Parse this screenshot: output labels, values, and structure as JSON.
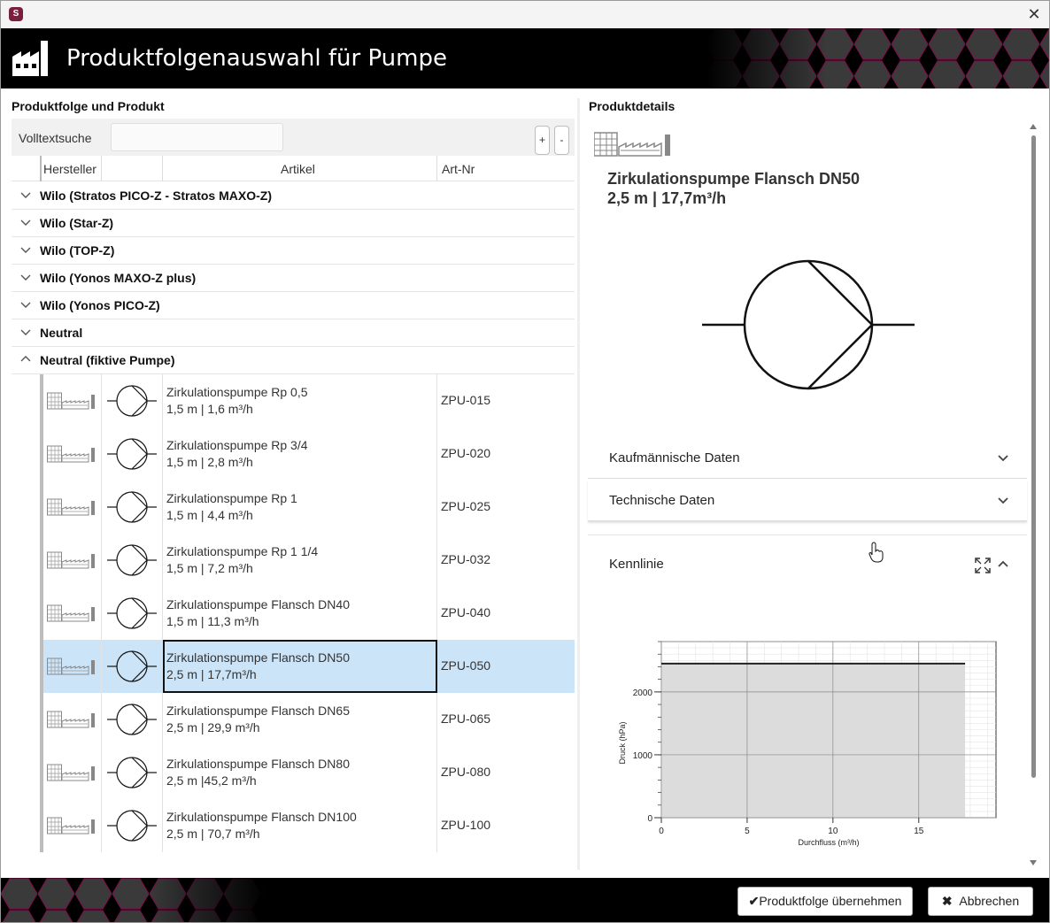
{
  "window": {
    "app_icon_letter": "S"
  },
  "header": {
    "title": "Produktfolgenauswahl für Pumpe"
  },
  "left": {
    "section_title": "Produktfolge und Produkt",
    "search_label": "Volltextsuche",
    "search_value": "",
    "expand_label": "+",
    "collapse_label": "-",
    "columns": {
      "hersteller": "Hersteller",
      "artikel": "Artikel",
      "artnr": "Art-Nr"
    },
    "groups": [
      {
        "label": "Wilo (Stratos PICO-Z - Stratos MAXO-Z)",
        "expanded": false
      },
      {
        "label": "Wilo (Star-Z)",
        "expanded": false
      },
      {
        "label": "Wilo (TOP-Z)",
        "expanded": false
      },
      {
        "label": "Wilo (Yonos MAXO-Z plus)",
        "expanded": false
      },
      {
        "label": "Wilo (Yonos PICO-Z)",
        "expanded": false
      },
      {
        "label": "Neutral",
        "expanded": false
      },
      {
        "label": "Neutral (fiktive Pumpe)",
        "expanded": true
      }
    ],
    "products": [
      {
        "name": "Zirkulationspumpe Rp 0,5",
        "spec": "1,5 m | 1,6 m³/h",
        "nr": "ZPU-015"
      },
      {
        "name": "Zirkulationspumpe Rp 3/4",
        "spec": "1,5 m | 2,8 m³/h",
        "nr": "ZPU-020"
      },
      {
        "name": "Zirkulationspumpe Rp 1",
        "spec": "1,5 m | 4,4 m³/h",
        "nr": "ZPU-025"
      },
      {
        "name": "Zirkulationspumpe Rp 1 1/4",
        "spec": "1,5 m | 7,2 m³/h",
        "nr": "ZPU-032"
      },
      {
        "name": "Zirkulationspumpe Flansch DN40",
        "spec": "1,5 m | 11,3 m³/h",
        "nr": "ZPU-040"
      },
      {
        "name": "Zirkulationspumpe Flansch DN50",
        "spec": "2,5 m | 17,7m³/h",
        "nr": "ZPU-050",
        "selected": true
      },
      {
        "name": "Zirkulationspumpe Flansch DN65",
        "spec": "2,5 m | 29,9 m³/h",
        "nr": "ZPU-065"
      },
      {
        "name": "Zirkulationspumpe Flansch DN80",
        "spec": "2,5 m |45,2 m³/h",
        "nr": "ZPU-080"
      },
      {
        "name": "Zirkulationspumpe Flansch DN100",
        "spec": "2,5 m | 70,7 m³/h",
        "nr": "ZPU-100"
      }
    ]
  },
  "right": {
    "section_title": "Produktdetails",
    "product_name": "Zirkulationspumpe Flansch DN50",
    "product_spec": "2,5 m | 17,7m³/h",
    "accordions": [
      {
        "label": "Kaufmännische Daten",
        "expanded": false
      },
      {
        "label": "Technische Daten",
        "expanded": false
      }
    ],
    "kennlinie_label": "Kennlinie"
  },
  "chart_data": {
    "type": "area",
    "title": "",
    "xlabel": "Durchfluss (m³/h)",
    "ylabel": "Druck (hPa)",
    "xlim": [
      0,
      19.5
    ],
    "ylim": [
      0,
      2800
    ],
    "xticks": [
      0,
      5,
      10,
      15
    ],
    "yticks": [
      0,
      1000,
      2000
    ],
    "grid": true,
    "series": [
      {
        "x": [
          0,
          17.7
        ],
        "y": [
          2450,
          2450
        ]
      }
    ],
    "colors": {
      "fill": "#dcdcdc",
      "line": "#222222"
    }
  },
  "footer": {
    "accept_label": "Produktfolge übernehmen",
    "cancel_label": "Abbrechen"
  },
  "colors": {
    "selection": "#cce4f7",
    "accent": "#b0146e"
  }
}
